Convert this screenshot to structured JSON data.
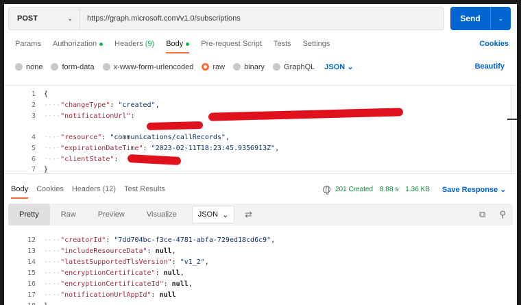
{
  "request": {
    "method": "POST",
    "url": "https://graph.microsoft.com/v1.0/subscriptions",
    "send_label": "Send"
  },
  "req_tabs": {
    "params": "Params",
    "authorization": "Authorization",
    "headers": "Headers",
    "headers_count": "(9)",
    "body": "Body",
    "prerequest": "Pre-request Script",
    "tests": "Tests",
    "settings": "Settings",
    "cookies": "Cookies"
  },
  "body_types": {
    "none": "none",
    "form_data": "form-data",
    "urlencoded": "x-www-form-urlencoded",
    "raw": "raw",
    "binary": "binary",
    "graphql": "GraphQL",
    "format": "JSON",
    "beautify": "Beautify"
  },
  "request_body": {
    "line_numbers": [
      "1",
      "2",
      "3",
      "",
      "4",
      "5",
      "6",
      "7"
    ],
    "open_brace": "{",
    "close_brace": "}",
    "change_type_key": "\"changeType\"",
    "change_type_value": "\"created\"",
    "notification_url_key": "\"notificationUrl\"",
    "resource_key": "\"resource\"",
    "resource_value": "\"communications/callRecords\"",
    "expiration_key": "\"expirationDateTime\"",
    "expiration_value": "\"2023-02-11T18:23:45.9356913Z\"",
    "client_state_key": "\"clientState\""
  },
  "response": {
    "tabs": {
      "body": "Body",
      "cookies": "Cookies",
      "headers": "Headers (12)",
      "test_results": "Test Results"
    },
    "status": "201 Created",
    "time": "8.88 s",
    "size": "1.36 KB",
    "save_label": "Save Response",
    "views": {
      "pretty": "Pretty",
      "raw": "Raw",
      "preview": "Preview",
      "visualize": "Visualize",
      "format": "JSON"
    }
  },
  "response_body": {
    "line_numbers": [
      "12",
      "13",
      "14",
      "15",
      "16",
      "17",
      "18"
    ],
    "creator_id_key": "\"creatorId\"",
    "creator_id_value": "\"7dd704bc-f3ce-4781-abfa-729ed18cd6c9\"",
    "include_resource_key": "\"includeResourceData\"",
    "include_resource_value": "null",
    "tls_key": "\"latestSupportedTlsVersion\"",
    "tls_value": "\"v1_2\"",
    "enc_cert_key": "\"encryptionCertificate\"",
    "enc_cert_value": "null",
    "enc_cert_id_key": "\"encryptionCertificateId\"",
    "enc_cert_id_value": "null",
    "notif_app_key": "\"notificationUrlAppId\"",
    "notif_app_value": "null",
    "close_brace": "}"
  },
  "colors": {
    "accent": "#ff6c37",
    "send_button": "#0265d2",
    "status_green": "#0a8a3b",
    "redaction": "#e0101c"
  },
  "icons": [
    "chevron-down-icon",
    "globe-icon",
    "wrap-lines-icon",
    "copy-icon",
    "search-icon"
  ]
}
